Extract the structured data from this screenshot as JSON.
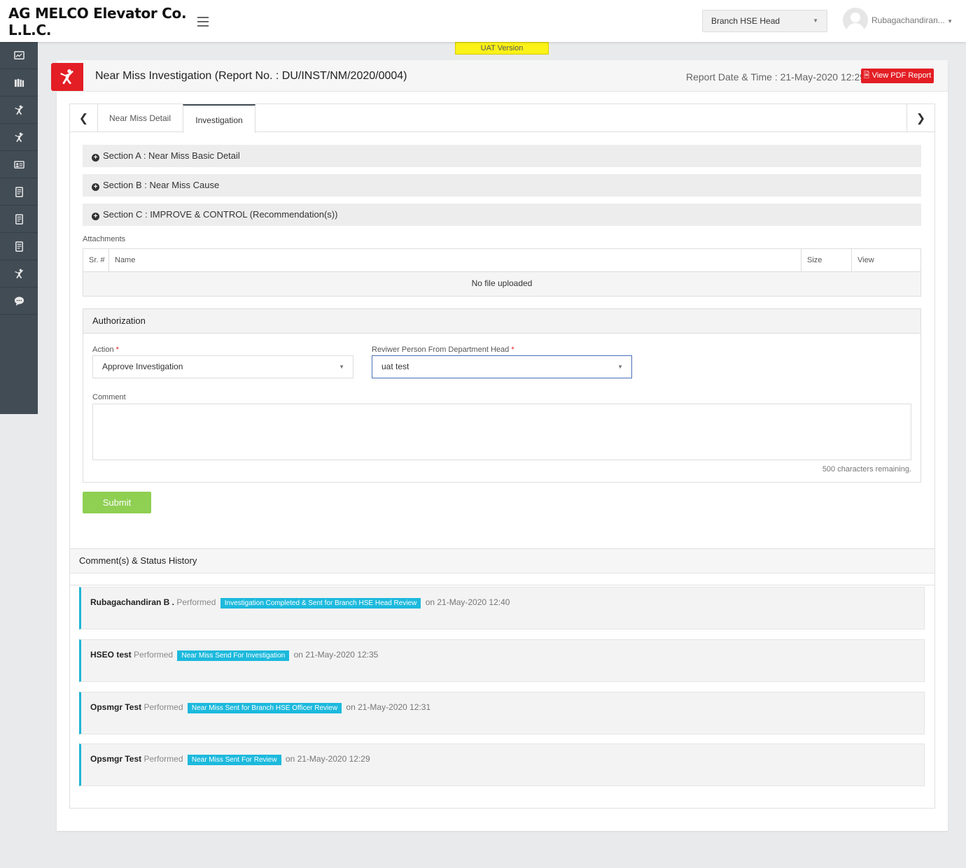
{
  "header": {
    "brand": "AG MELCO Elevator Co.\nL.L.C.",
    "brand_line1": "AG MELCO Elevator Co.",
    "brand_line2": "L.L.C.",
    "role": "Branch HSE Head",
    "username": "Rubagachandiran..."
  },
  "uat_label": "UAT Version",
  "sidebar": {
    "items": [
      {
        "icon": "dashboard-icon"
      },
      {
        "icon": "library-icon"
      },
      {
        "icon": "incident-icon"
      },
      {
        "icon": "near-miss-icon"
      },
      {
        "icon": "id-card-icon"
      },
      {
        "icon": "report-icon"
      },
      {
        "icon": "report-icon"
      },
      {
        "icon": "report-icon"
      },
      {
        "icon": "incident-icon"
      },
      {
        "icon": "chat-icon"
      }
    ]
  },
  "page": {
    "title": "Near Miss Investigation (Report No. : DU/INST/NM/2020/0004)",
    "report_date": "Report Date & Time : 21-May-2020 12:29",
    "pdf_button": "View PDF Report"
  },
  "tabs": [
    {
      "label": "Near Miss Detail",
      "active": false
    },
    {
      "label": "Investigation",
      "active": true
    }
  ],
  "sections": [
    {
      "label": "Section A : Near Miss Basic Detail"
    },
    {
      "label": "Section B : Near Miss Cause"
    },
    {
      "label": "Section C : IMPROVE & CONTROL (Recommendation(s))"
    }
  ],
  "attachments": {
    "label": "Attachments",
    "columns": [
      "Sr. #",
      "Name",
      "Size",
      "View"
    ],
    "empty_text": "No file uploaded"
  },
  "authorization": {
    "title": "Authorization",
    "action_label": "Action",
    "action_value": "Approve Investigation",
    "reviewer_label": "Reviwer Person From Department Head",
    "reviewer_value": "uat test",
    "comment_label": "Comment",
    "comment_value": "",
    "chars_remaining": "500 characters remaining.",
    "required_mark": "*"
  },
  "submit_label": "Submit",
  "history": {
    "title": "Comment(s) & Status History",
    "items": [
      {
        "who": "Rubagachandiran B .",
        "performed": "Performed",
        "status": "Investigation Completed & Sent for Branch HSE Head Review",
        "when": "on 21-May-2020 12:40"
      },
      {
        "who": "HSEO test",
        "performed": "Performed",
        "status": "Near Miss Send For Investigation",
        "when": "on 21-May-2020 12:35"
      },
      {
        "who": "Opsmgr Test",
        "performed": "Performed",
        "status": "Near Miss Sent for Branch HSE Officer Review",
        "when": "on 21-May-2020 12:31"
      },
      {
        "who": "Opsmgr Test",
        "performed": "Performed",
        "status": "Near Miss Sent For Review",
        "when": "on 21-May-2020 12:29"
      }
    ]
  },
  "colors": {
    "accent_red": "#e31e24",
    "sidebar": "#424c55",
    "badge": "#1cb9dd",
    "submit": "#8fcf52",
    "uat": "#fbf218"
  }
}
